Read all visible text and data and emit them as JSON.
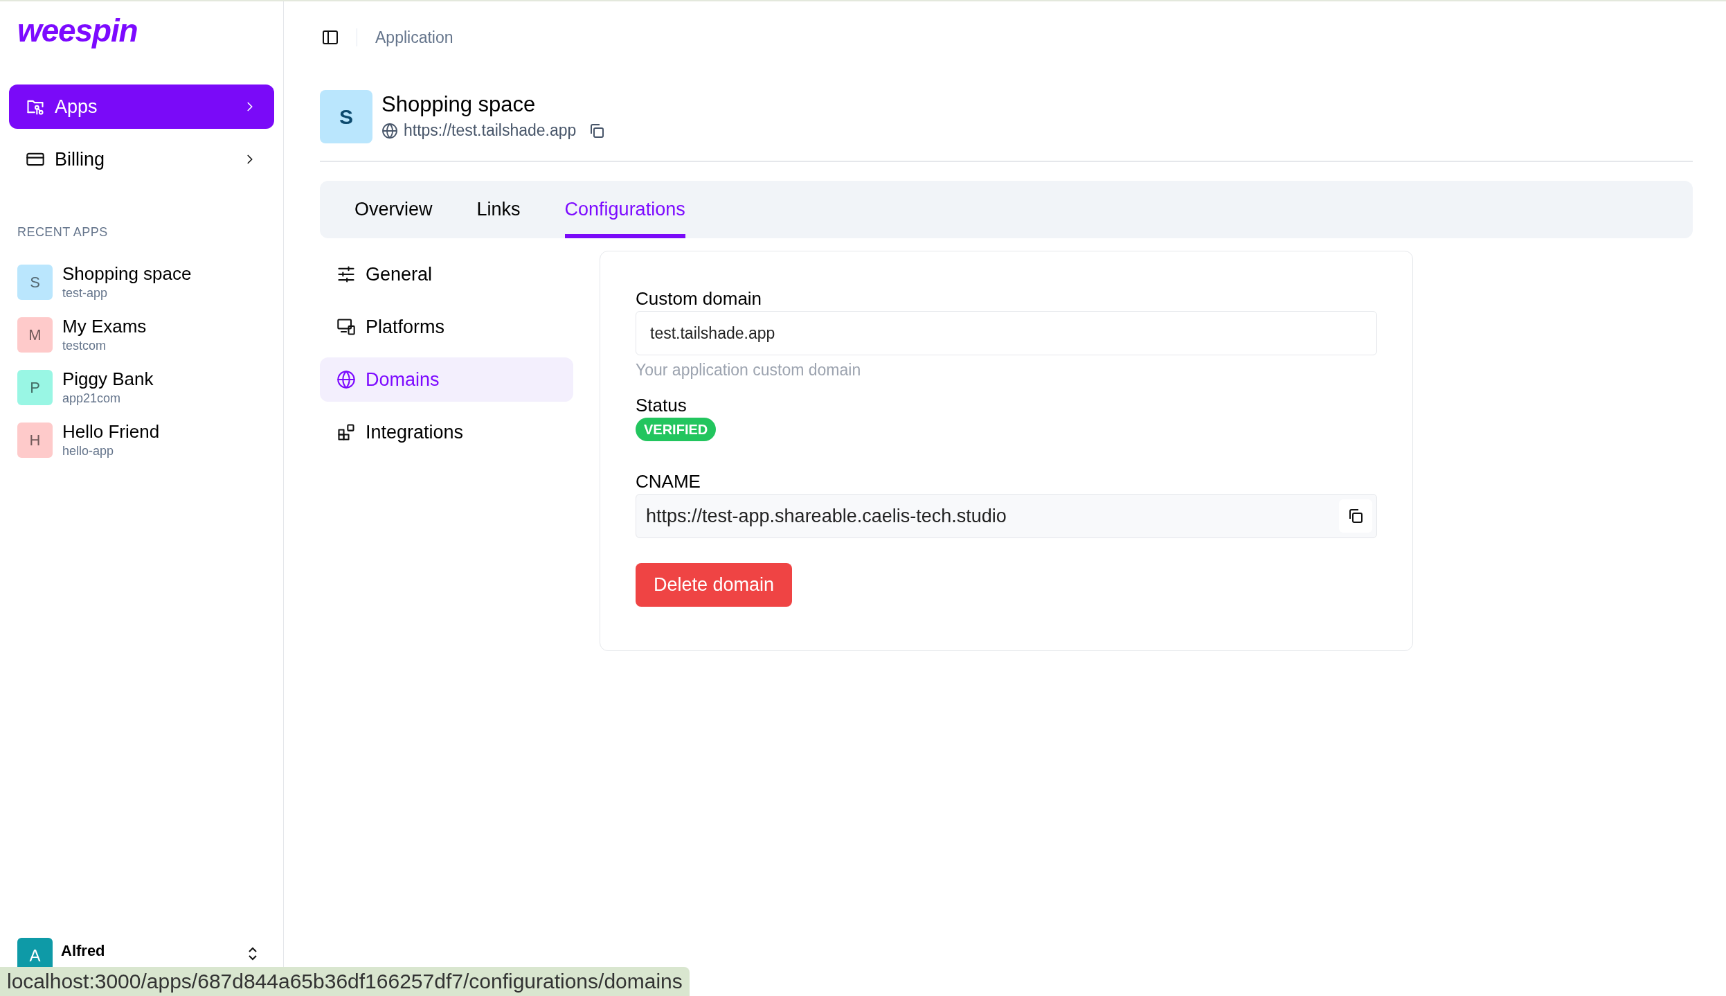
{
  "logo": "weespin",
  "nav": [
    {
      "label": "Apps",
      "selected": true,
      "kind": "folder"
    },
    {
      "label": "Billing",
      "selected": false,
      "kind": "card"
    }
  ],
  "recent_apps": {
    "heading": "RECENT APPS",
    "items": [
      {
        "initial": "S",
        "name": "Shopping space",
        "slug": "test-app",
        "color": "#bae6fd"
      },
      {
        "initial": "M",
        "name": "My Exams",
        "slug": "testcom",
        "color": "#fecaca"
      },
      {
        "initial": "P",
        "name": "Piggy Bank",
        "slug": "app21com",
        "color": "#99f6e4"
      },
      {
        "initial": "H",
        "name": "Hello Friend",
        "slug": "hello-app",
        "color": "#fecaca"
      }
    ]
  },
  "user": {
    "initial": "A",
    "name": "Alfred"
  },
  "breadcrumb": "Application",
  "app": {
    "initial": "S",
    "name": "Shopping space",
    "url": "https://test.tailshade.app"
  },
  "tabs": [
    {
      "label": "Overview",
      "selected": false
    },
    {
      "label": "Links",
      "selected": false
    },
    {
      "label": "Configurations",
      "selected": true
    }
  ],
  "config_menu": [
    {
      "label": "General",
      "selected": false,
      "kind": "sliders"
    },
    {
      "label": "Platforms",
      "selected": false,
      "kind": "devices"
    },
    {
      "label": "Domains",
      "selected": true,
      "kind": "globe"
    },
    {
      "label": "Integrations",
      "selected": false,
      "kind": "blocks"
    }
  ],
  "domain": {
    "custom_domain": {
      "label": "Custom domain",
      "value": "test.tailshade.app",
      "help": "Your application custom domain"
    },
    "status": {
      "label": "Status",
      "badge": "VERIFIED"
    },
    "cname": {
      "label": "CNAME",
      "value": "https://test-app.shareable.caelis-tech.studio"
    },
    "delete_button": "Delete domain"
  },
  "status_bar": "localhost:3000/apps/687d844a65b36df166257df7/configurations/domains"
}
